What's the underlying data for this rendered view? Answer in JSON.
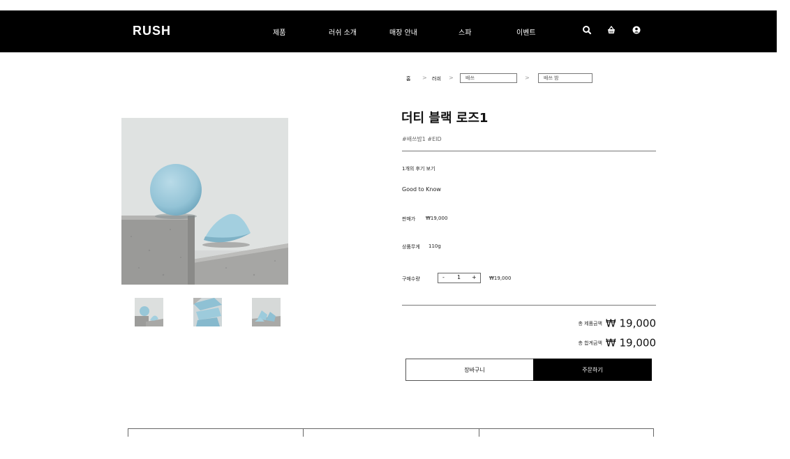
{
  "brand": {
    "logo": "RUSH"
  },
  "nav": {
    "items": [
      "제품",
      "러쉬 소개",
      "매장 안내",
      "스파",
      "이벤트"
    ],
    "icons": [
      "search-icon",
      "basket-icon",
      "user-icon"
    ]
  },
  "breadcrumb": {
    "home": "홈",
    "sep": ">",
    "level1": "러쉬",
    "select1": "배쓰",
    "select2": "배쓰 밤"
  },
  "product": {
    "name": "더티 블랙 로즈1",
    "tags": "#배쓰밤1 #EID",
    "review_link": "1개의 후기 보기",
    "good_to_know": "Good to Know",
    "price_label": "판매가",
    "price_value": "₩19,000",
    "weight_label": "상품무게",
    "weight_value": "110g",
    "qty_label": "구매수량",
    "qty_minus": "-",
    "qty_value": "1",
    "qty_plus": "+",
    "qty_line_price": "₩19,000"
  },
  "totals": {
    "product_total_label": "총 제품금액",
    "product_total_value": "₩ 19,000",
    "grand_total_label": "총 합계금액",
    "grand_total_value": "₩ 19,000"
  },
  "actions": {
    "cart": "장바구니",
    "order": "주문하기"
  },
  "colors": {
    "header_bg": "#000000",
    "product_blue": "#9cc8d9",
    "concrete": "#a9a9a7"
  }
}
